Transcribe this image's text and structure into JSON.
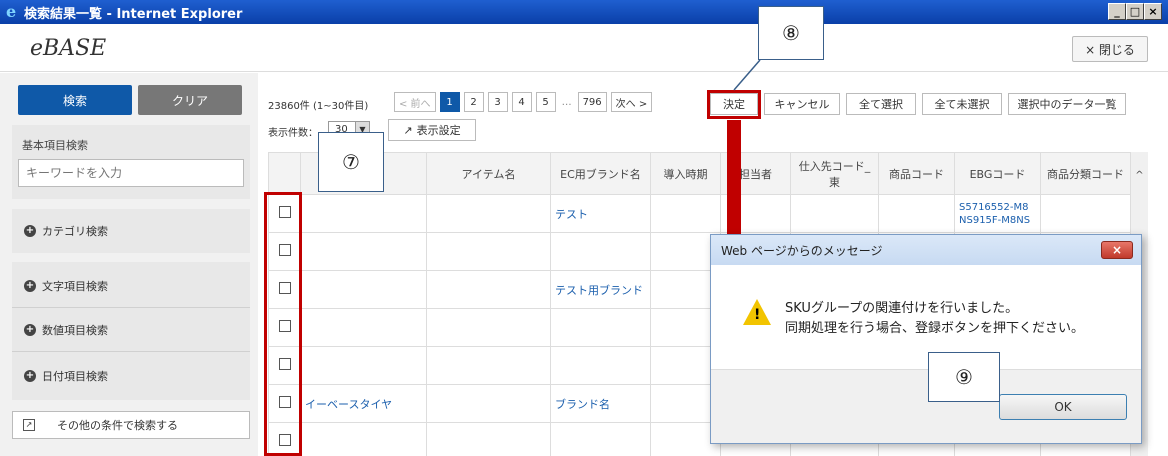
{
  "window": {
    "title": "検索結果一覧 - Internet Explorer",
    "ie_icon": "e",
    "minimize": "_",
    "restore": "□",
    "close": "×"
  },
  "app": {
    "logo": "eBASE",
    "close_label": "× 閉じる"
  },
  "sidebar": {
    "search_label": "検索",
    "clear_label": "クリア",
    "basic_label": "基本項目検索",
    "keyword_placeholder": "キーワードを入力",
    "category_label": "カテゴリ検索",
    "text_label": "文字項目検索",
    "number_label": "数値項目検索",
    "date_label": "日付項目検索",
    "other_label": "その他の条件で検索する"
  },
  "toolbar": {
    "count": "23860件 (1~30件目)",
    "prev": "< 前へ",
    "pages": [
      "1",
      "2",
      "3",
      "4",
      "5"
    ],
    "ellipsis": "…",
    "last_page": "796",
    "next": "次へ >",
    "decide": "決定",
    "cancel": "キャンセル",
    "select_all": "全て選択",
    "deselect_all": "全て未選択",
    "selected_list": "選択中のデータ一覧",
    "per_page_label": "表示件数：",
    "per_page_value": "30",
    "display_settings": "表示設定"
  },
  "table": {
    "headers": [
      "",
      "…)",
      "アイテム名",
      "EC用ブランド名",
      "導入時期",
      "担当者",
      "仕入先コード_東",
      "商品コード",
      "EBGコード",
      "商品分類コード"
    ],
    "rows": [
      {
        "name": "",
        "brand": "テスト",
        "ebg": "S5716552-M8 NS915F-M8NS"
      },
      {
        "name": "",
        "brand": "",
        "ebg": ""
      },
      {
        "name": "",
        "brand": "テスト用ブランド",
        "ebg": ""
      },
      {
        "name": "",
        "brand": "",
        "ebg": ""
      },
      {
        "name": "",
        "brand": "",
        "ebg": ""
      },
      {
        "name": "イーベースタイヤ",
        "brand": "ブランド名",
        "ebg": ""
      },
      {
        "name": "",
        "brand": "",
        "ebg": ""
      }
    ]
  },
  "annotations": {
    "a7": "⑦",
    "a8": "⑧",
    "a9": "⑨"
  },
  "dialog": {
    "title": "Web ページからのメッセージ",
    "close": "×",
    "message_line1": "SKUグループの関連付けを行いました。",
    "message_line2": "同期処理を行う場合、登録ボタンを押下ください。",
    "ok": "OK"
  }
}
